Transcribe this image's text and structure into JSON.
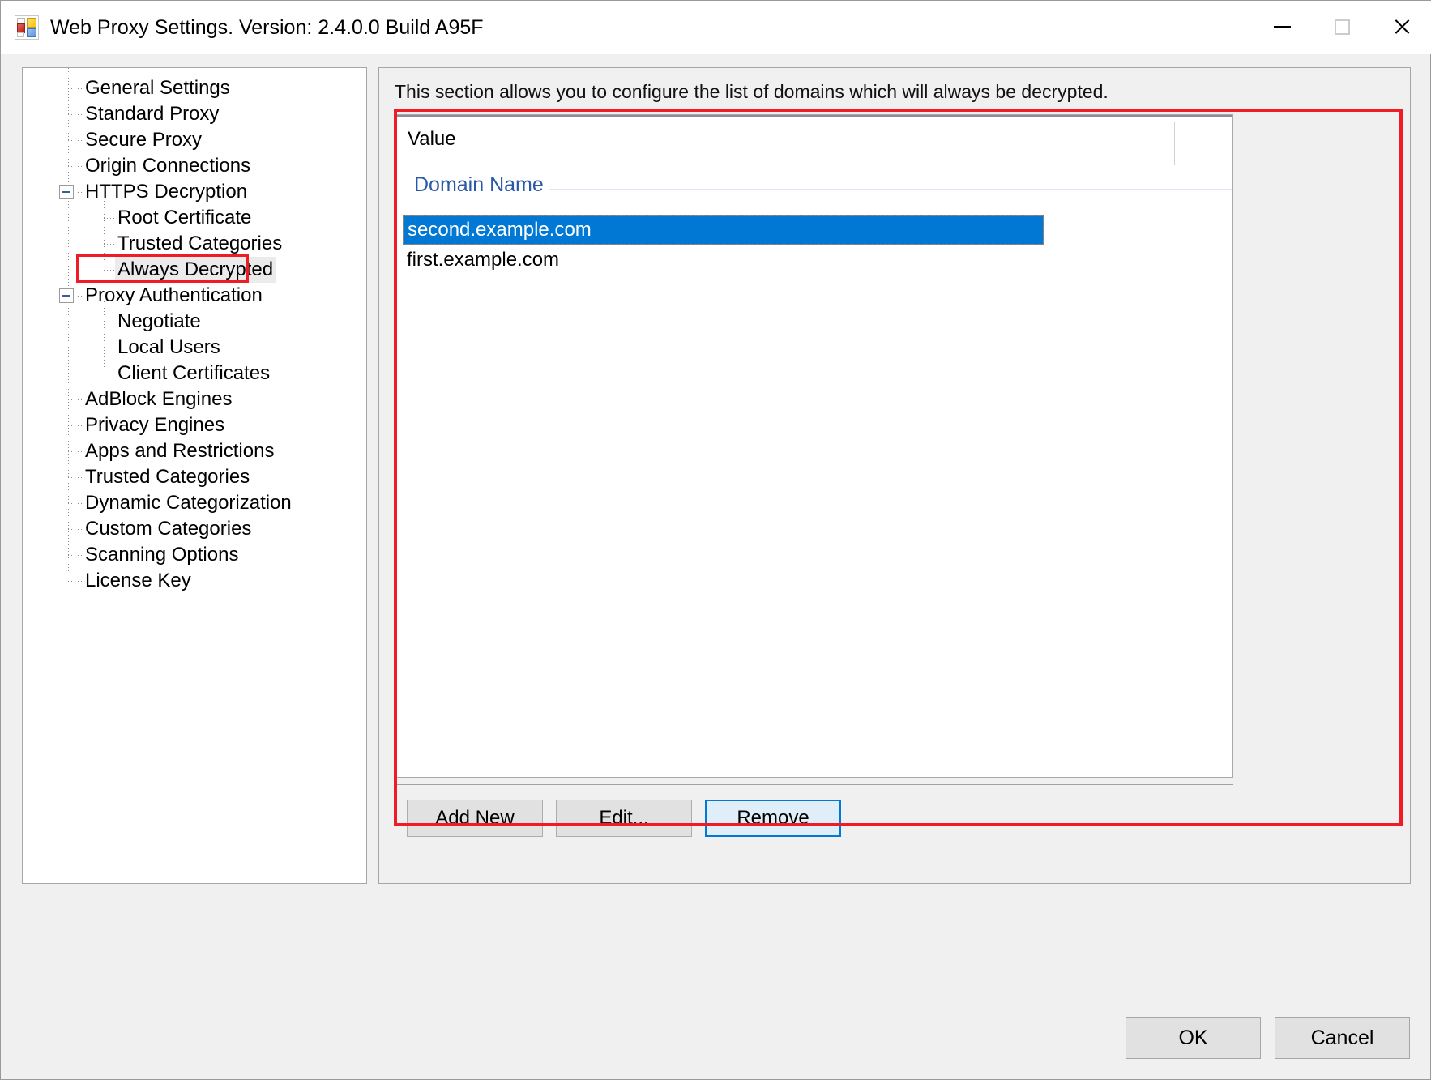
{
  "window": {
    "title": "Web Proxy Settings. Version: 2.4.0.0 Build A95F",
    "icon": "app-tiles-icon",
    "controls": {
      "minimize": "minimize-icon",
      "maximize": "maximize-icon",
      "close": "close-icon"
    }
  },
  "tree": {
    "items": [
      {
        "label": "General Settings",
        "level": 0,
        "expander": false,
        "selected": false
      },
      {
        "label": "Standard Proxy",
        "level": 0,
        "expander": false,
        "selected": false
      },
      {
        "label": "Secure Proxy",
        "level": 0,
        "expander": false,
        "selected": false
      },
      {
        "label": "Origin Connections",
        "level": 0,
        "expander": false,
        "selected": false
      },
      {
        "label": "HTTPS Decryption",
        "level": 0,
        "expander": true,
        "selected": false
      },
      {
        "label": "Root Certificate",
        "level": 1,
        "expander": false,
        "selected": false
      },
      {
        "label": "Trusted Categories",
        "level": 1,
        "expander": false,
        "selected": false
      },
      {
        "label": "Always Decrypted",
        "level": 1,
        "expander": false,
        "selected": true
      },
      {
        "label": "Proxy Authentication",
        "level": 0,
        "expander": true,
        "selected": false
      },
      {
        "label": "Negotiate",
        "level": 1,
        "expander": false,
        "selected": false
      },
      {
        "label": "Local Users",
        "level": 1,
        "expander": false,
        "selected": false
      },
      {
        "label": "Client Certificates",
        "level": 1,
        "expander": false,
        "selected": false
      },
      {
        "label": "AdBlock Engines",
        "level": 0,
        "expander": false,
        "selected": false
      },
      {
        "label": "Privacy Engines",
        "level": 0,
        "expander": false,
        "selected": false
      },
      {
        "label": "Apps and Restrictions",
        "level": 0,
        "expander": false,
        "selected": false
      },
      {
        "label": "Trusted Categories",
        "level": 0,
        "expander": false,
        "selected": false
      },
      {
        "label": "Dynamic Categorization",
        "level": 0,
        "expander": false,
        "selected": false
      },
      {
        "label": "Custom Categories",
        "level": 0,
        "expander": false,
        "selected": false
      },
      {
        "label": "Scanning Options",
        "level": 0,
        "expander": false,
        "selected": false
      },
      {
        "label": "License Key",
        "level": 0,
        "expander": false,
        "selected": false
      }
    ]
  },
  "main": {
    "description": "This section allows you to configure the list of domains which will always be decrypted.",
    "list": {
      "column_header": "Value",
      "group_header": "Domain Name",
      "rows": [
        {
          "value": "second.example.com",
          "selected": true
        },
        {
          "value": "first.example.com",
          "selected": false
        }
      ]
    },
    "buttons": {
      "add_new": "Add New",
      "edit": "Edit...",
      "remove": "Remove"
    }
  },
  "footer": {
    "ok": "OK",
    "cancel": "Cancel"
  },
  "colors": {
    "selection": "#0078d4",
    "group_header": "#2a59a8",
    "annotation": "#ef1c25",
    "focus_border": "#0078d7"
  }
}
